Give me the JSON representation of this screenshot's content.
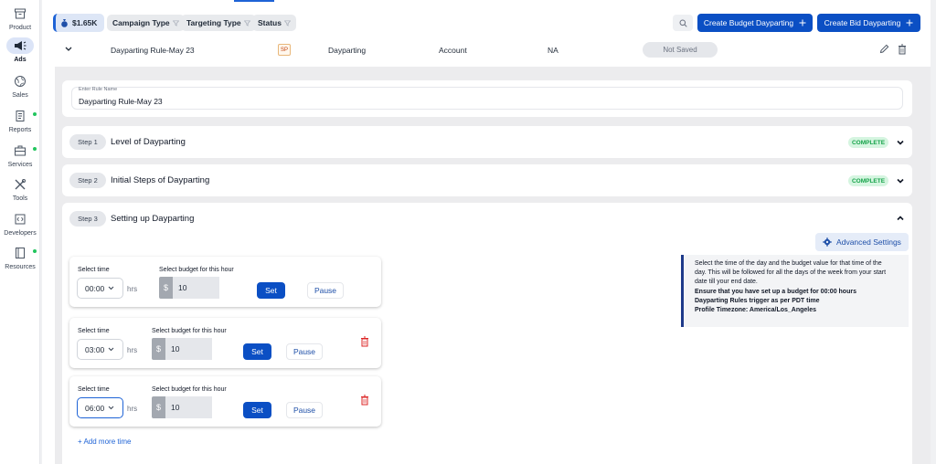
{
  "sidebar": {
    "items": [
      {
        "label": "Product",
        "icon": "box-icon"
      },
      {
        "label": "Ads",
        "icon": "megaphone-icon"
      },
      {
        "label": "Sales",
        "icon": "globe-icon"
      },
      {
        "label": "Reports",
        "icon": "document-icon"
      },
      {
        "label": "Services",
        "icon": "briefcase-icon"
      },
      {
        "label": "Tools",
        "icon": "tools-icon"
      },
      {
        "label": "Developers",
        "icon": "code-icon"
      },
      {
        "label": "Resources",
        "icon": "book-icon"
      }
    ]
  },
  "toolbar": {
    "budget": "$1.65K",
    "filters": [
      "Campaign Type",
      "Targeting Type",
      "Status"
    ],
    "create_budget_label": "Create Budget Dayparting",
    "create_bid_label": "Create Bid Dayparting"
  },
  "rule_row": {
    "name": "Dayparting Rule-May 23",
    "ad_type": "SP",
    "type": "Dayparting",
    "level": "Account",
    "value": "NA",
    "status": "Not Saved"
  },
  "editor": {
    "rule_name_label": "Enter Rule Name",
    "rule_name_value": "Dayparting Rule-May 23",
    "steps": [
      {
        "pill": "Step 1",
        "title": "Level of Dayparting",
        "status": "COMPLETE"
      },
      {
        "pill": "Step 2",
        "title": "Initial Steps of Dayparting",
        "status": "COMPLETE"
      },
      {
        "pill": "Step 3",
        "title": "Setting up Dayparting"
      }
    ],
    "advanced_settings_label": "Advanced Settings",
    "info": {
      "line1": "Select the time of the day and the budget value for that time of the",
      "line2": "day. This will be followed for all the days of the week from your start",
      "line3": "date till your end date.",
      "line4": "Ensure that you have set up a budget for 00:00 hours",
      "line5": "Dayparting Rules trigger as per PDT time",
      "line6": "Profile Timezone: America/Los_Angeles"
    },
    "time_label": "Select time",
    "budget_label": "Select budget for this hour",
    "hrs_label": "hrs",
    "currency": "$",
    "set_label": "Set",
    "pause_label": "Pause",
    "time_slots": [
      {
        "time": "00:00",
        "budget": "10"
      },
      {
        "time": "03:00",
        "budget": "10"
      },
      {
        "time": "06:00",
        "budget": "10"
      }
    ],
    "add_more_label": "+ Add more time"
  },
  "colors": {
    "primary": "#0b4fc4",
    "complete_bg": "#d5f5e0",
    "complete_text": "#16a34a",
    "delete": "#dc2626"
  }
}
